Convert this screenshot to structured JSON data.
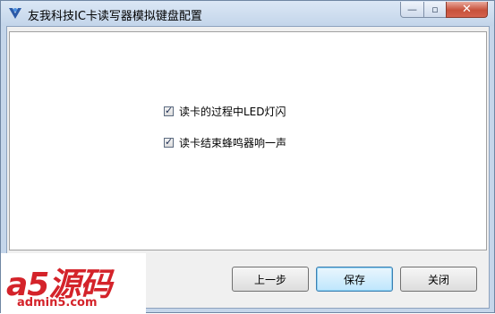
{
  "window": {
    "title": "友我科技IC卡读写器模拟键盘配置",
    "controls": {
      "minimize": "—",
      "maximize": "▫",
      "close": "✕"
    }
  },
  "options": [
    {
      "label": "读卡的过程中LED灯闪",
      "checked": true
    },
    {
      "label": "读卡结束蜂鸣器响一声",
      "checked": true
    }
  ],
  "buttons": {
    "prev": "上一步",
    "save": "保存",
    "close": "关闭"
  },
  "watermark": {
    "main": "a5源码",
    "sub": "admin5.com"
  },
  "colors": {
    "accent": "#3c7fb1",
    "watermark": "#d4232a",
    "close_button": "#c7513b"
  }
}
